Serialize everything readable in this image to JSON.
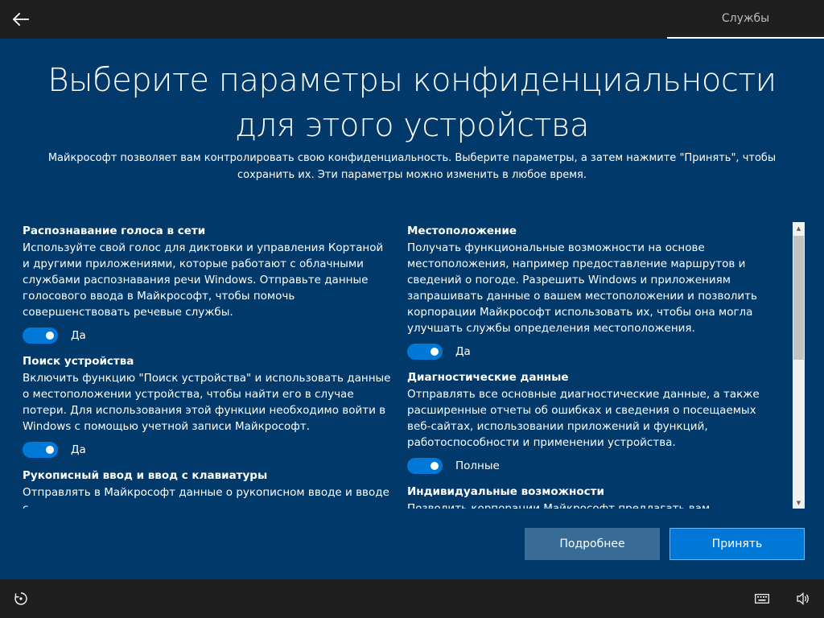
{
  "topbar": {
    "back_icon": "arrow-left-icon",
    "tab_label": "Службы"
  },
  "title": "Выберите параметры конфиденциальности для этого устройства",
  "subtitle": "Майкрософт позволяет вам контролировать свою конфиденциальность. Выберите параметры, а затем нажмите \"Принять\", чтобы сохранить их. Эти параметры можно изменить в любое время.",
  "left_column": [
    {
      "heading": "Распознавание голоса в сети",
      "description": "Используйте свой голос для диктовки и управления Кортаной и другими приложениями, которые работают с облачными службами распознавания речи Windows. Отправьте данные голосового ввода в Майкрософт, чтобы помочь совершенствовать речевые службы.",
      "toggle_label": "Да",
      "toggle_on": true
    },
    {
      "heading": "Поиск устройства",
      "description": "Включить функцию \"Поиск устройства\" и использовать данные о местоположении устройства, чтобы найти его в случае потери. Для использования этой функции необходимо войти в Windows с помощью учетной записи Майкрософт.",
      "toggle_label": "Да",
      "toggle_on": true
    },
    {
      "heading": "Рукописный ввод и ввод с клавиатуры",
      "description": "Отправлять в Майкрософт данные о рукописном вводе и вводе с"
    }
  ],
  "right_column": [
    {
      "heading": "Местоположение",
      "description": "Получать функциональные возможности на основе местоположения, например предоставление маршрутов и сведений о погоде. Разрешить Windows и приложениям запрашивать данные о вашем местоположении и позволить корпорации Майкрософт использовать их, чтобы она могла улучшать службы определения местоположения.",
      "toggle_label": "Да",
      "toggle_on": true
    },
    {
      "heading": "Диагностические данные",
      "description": "Отправлять все основные диагностические данные, а также расширенные отчеты об ошибках и сведения о посещаемых веб-сайтах, использовании приложений и функций, работоспособности и применении устройства.",
      "toggle_label": "Полные",
      "toggle_on": true
    },
    {
      "heading": "Индивидуальные возможности",
      "description": "Позволить корпорации Майкрософт предлагать вам"
    }
  ],
  "buttons": {
    "more": "Подробнее",
    "accept": "Принять"
  },
  "bottombar": {
    "ease_of_access_icon": "ease-of-access-icon",
    "keyboard_icon": "keyboard-icon",
    "volume_icon": "volume-icon"
  },
  "colors": {
    "background": "#01396a",
    "bar": "#1f1f1f",
    "accent": "#0078d7",
    "secondary_button": "#396b97"
  }
}
